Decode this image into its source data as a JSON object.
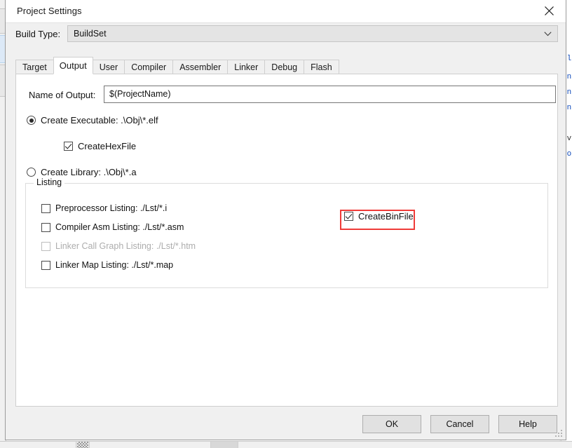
{
  "window": {
    "title": "Project Settings",
    "close_icon": "close-icon"
  },
  "build_type": {
    "label": "Build Type:",
    "value": "BuildSet",
    "arrow_icon": "chevron-down-icon"
  },
  "tabs": [
    {
      "label": "Target",
      "selected": false
    },
    {
      "label": "Output",
      "selected": true
    },
    {
      "label": "User",
      "selected": false
    },
    {
      "label": "Compiler",
      "selected": false
    },
    {
      "label": "Assembler",
      "selected": false
    },
    {
      "label": "Linker",
      "selected": false
    },
    {
      "label": "Debug",
      "selected": false
    },
    {
      "label": "Flash",
      "selected": false
    }
  ],
  "output": {
    "name_label": "Name of Output:",
    "name_value": "$(ProjectName)",
    "name_placeholder": "",
    "create_executable": {
      "label": "Create Executable: .\\Obj\\*.elf",
      "checked": true
    },
    "create_hex_file": {
      "label": "CreateHexFile",
      "checked": true
    },
    "create_bin_file": {
      "label": "CreateBinFile",
      "checked": true,
      "highlight_color": "#ef3b38"
    },
    "create_library": {
      "label": "Create Library: .\\Obj\\*.a",
      "checked": false
    }
  },
  "listing": {
    "legend": "Listing",
    "items": [
      {
        "label": "Preprocessor Listing: ./Lst/*.i",
        "checked": false,
        "disabled": false
      },
      {
        "label": "Compiler Asm Listing: ./Lst/*.asm",
        "checked": false,
        "disabled": false
      },
      {
        "label": "Linker Call Graph Listing: ./Lst/*.htm",
        "checked": false,
        "disabled": true
      },
      {
        "label": "Linker Map Listing: ./Lst/*.map",
        "checked": false,
        "disabled": false
      }
    ]
  },
  "buttons": {
    "ok": "OK",
    "cancel": "Cancel",
    "help": "Help"
  },
  "background_editor": {
    "fragments": [
      "ile",
      "in",
      "in",
      "in",
      "(v",
      "vo"
    ]
  }
}
